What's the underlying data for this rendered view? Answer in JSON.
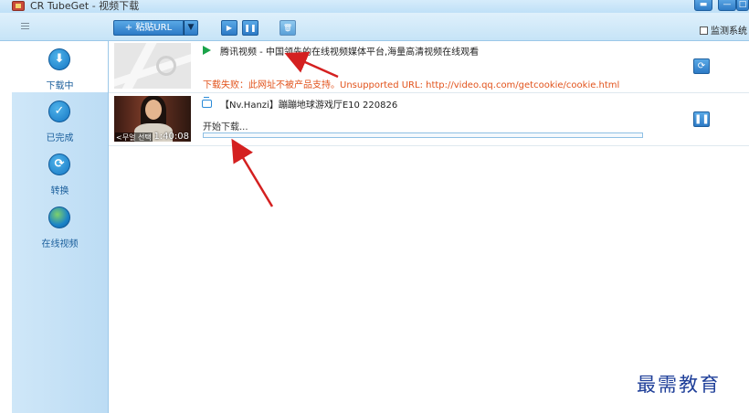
{
  "window": {
    "title": "CR TubeGet - 视频下载",
    "controls": [
      "minimize-icon",
      "restore-icon"
    ]
  },
  "toolbar": {
    "paste_label": "+ 粘贴URL",
    "dropdown_icon": "chevron-down-icon",
    "play_icon": "play-icon",
    "pause_icon": "pause-icon",
    "delete_icon": "trash-icon",
    "monitor_label": "监测系统"
  },
  "sidebar": {
    "items": [
      {
        "label": "下载中",
        "icon": "download-icon",
        "active": true
      },
      {
        "label": "已完成",
        "icon": "check-icon",
        "active": false
      },
      {
        "label": "转换",
        "icon": "convert-icon",
        "active": false
      },
      {
        "label": "在线视频",
        "icon": "globe-icon",
        "active": false
      }
    ]
  },
  "downloads": [
    {
      "site_icon": "tencent-video-icon",
      "title": "腾讯视频 - 中国领先的在线视频媒体平台,海量高清视频在线观看",
      "error": "下载失败：此网址不被产品支持。Unsupported URL: http://video.qq.com/getcookie/cookie.html",
      "action_icon": "retry-icon"
    },
    {
      "site_icon": "bilibili-tv-icon",
      "title": "【Nv.Hanzi】蹦蹦地球游戏厅E10 220826",
      "status": "开始下载...",
      "progress": 0,
      "duration": "1:40:08",
      "thumb_caption": "<무얼 선택",
      "action_icon": "pause-icon"
    }
  ],
  "watermark": "最需教育",
  "colors": {
    "accent": "#2c7ac6",
    "sidebar": "#c6e2f6",
    "error": "#e2531c",
    "annotation_arrow": "#d42020"
  }
}
